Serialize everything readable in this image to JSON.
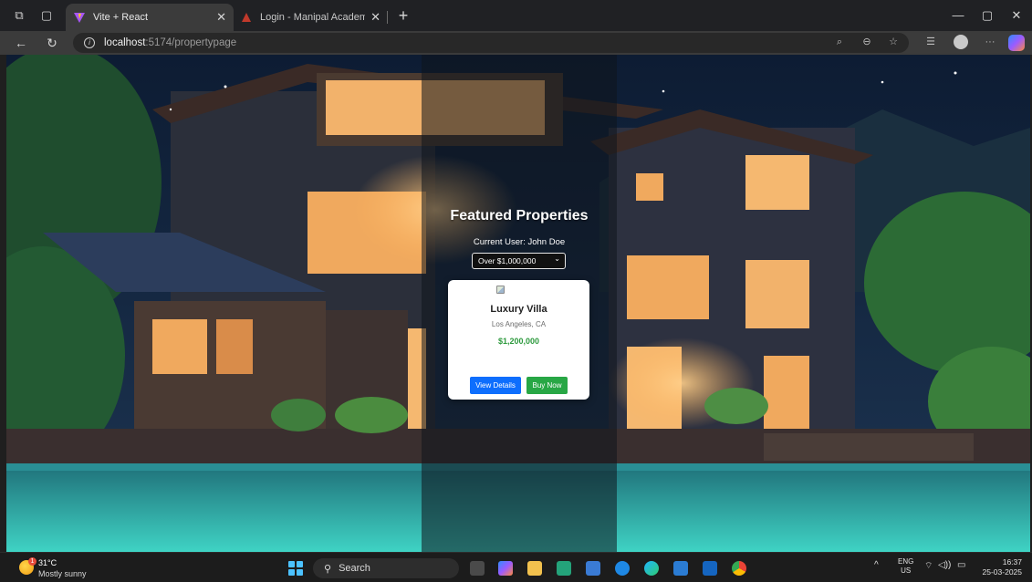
{
  "browser": {
    "tabs": [
      {
        "title": "Vite + React",
        "active": true
      },
      {
        "title": "Login - Manipal Academy of High",
        "active": false
      }
    ],
    "url_host": "localhost",
    "url_path": ":5174/propertypage",
    "icons": {
      "workspaces": "⧉",
      "tab_actions": "▢",
      "close": "✕",
      "new_tab": "+",
      "minimize": "—",
      "restore": "▢",
      "window_close": "✕",
      "back": "←",
      "reload": "↻",
      "site_info": "i",
      "read_aloud": "⌕",
      "zoom": "⊖",
      "favorite": "☆",
      "favorites_bar": "☰",
      "more": "···"
    }
  },
  "page": {
    "heading": "Featured Properties",
    "current_user": "Current User: John Doe",
    "filter": {
      "selected": "Over $1,000,000",
      "chevron": "⌄"
    },
    "property": {
      "name": "Luxury Villa",
      "location": "Los Angeles, CA",
      "price": "$1,200,000",
      "view_details_label": "View Details",
      "buy_now_label": "Buy Now"
    },
    "colors": {
      "primary_button": "#0d6efd",
      "buy_button": "#28a745",
      "price_text": "#2e9a3e"
    }
  },
  "taskbar": {
    "weather": {
      "temp": "31°C",
      "condition": "Mostly sunny",
      "badge": "1"
    },
    "search_label": "Search",
    "search_icon": "⚲",
    "tray": {
      "chevron": "^",
      "lang_top": "ENG",
      "lang_bottom": "US",
      "wifi": "⌔",
      "volume": "◁))",
      "battery": "▭"
    },
    "clock": {
      "time": "16:37",
      "date": "25-03-2025"
    }
  }
}
